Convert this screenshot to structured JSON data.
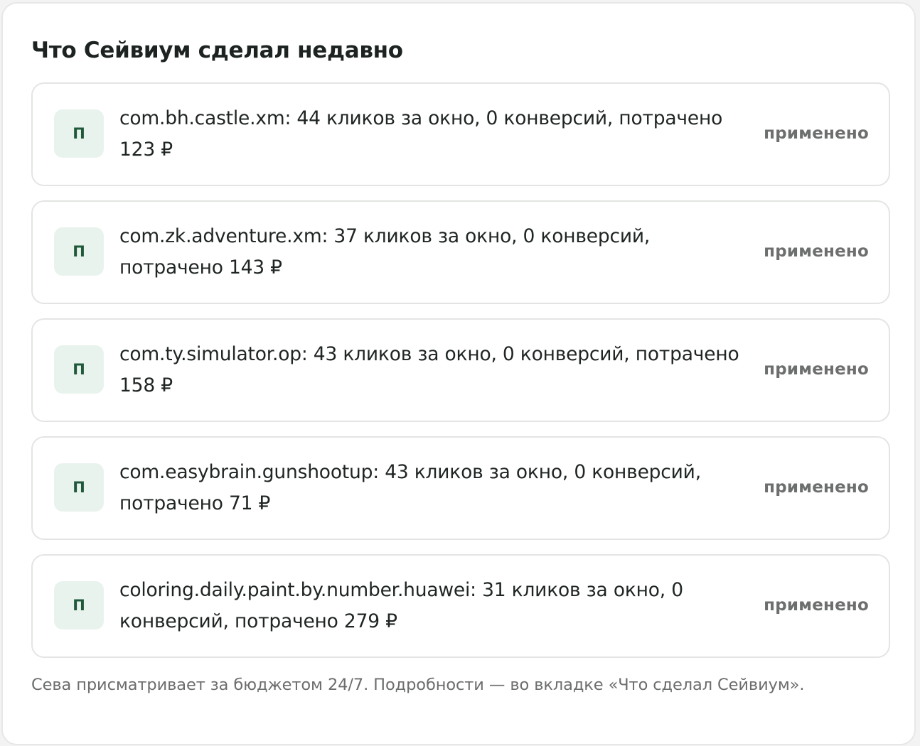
{
  "panel": {
    "title": "Что Сейвиум сделал недавно",
    "items": [
      {
        "badge": "П",
        "text": "com.bh.castle.xm: 44 кликов за окно, 0 конверсий, потрачено 123 ₽",
        "status": "применено"
      },
      {
        "badge": "П",
        "text": "com.zk.adventure.xm: 37 кликов за окно, 0 конверсий, потрачено 143 ₽",
        "status": "применено"
      },
      {
        "badge": "П",
        "text": "com.ty.simulator.op: 43 кликов за окно, 0 конверсий, потрачено 158 ₽",
        "status": "применено"
      },
      {
        "badge": "П",
        "text": "com.easybrain.gunshootup: 43 кликов за окно, 0 конверсий, потрачено 71 ₽",
        "status": "применено"
      },
      {
        "badge": "П",
        "text": "coloring.daily.paint.by.number.huawei: 31 кликов за окно, 0 конверсий, потрачено 279 ₽",
        "status": "применено"
      }
    ],
    "footer": "Сева присматривает за бюджетом 24/7. Подробности — во вкладке «Что сделал Сейвиум»."
  },
  "colors": {
    "background": "#f3f3f3",
    "panel": "#ffffff",
    "border": "#e3e5e3",
    "badge_bg": "#e9f3ed",
    "badge_text": "#20583a",
    "text": "#1f2522",
    "muted": "#6d6f6e"
  }
}
